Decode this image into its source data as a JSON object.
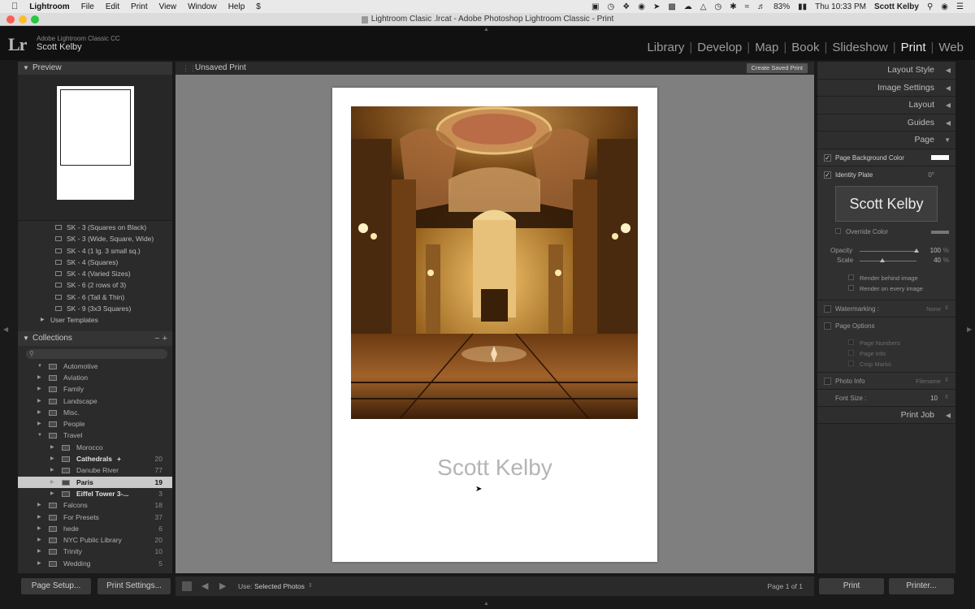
{
  "menubar": {
    "app": "Lightroom",
    "items": [
      "File",
      "Edit",
      "Print",
      "View",
      "Window",
      "Help"
    ],
    "battery": "83%",
    "clock": "Thu 10:33 PM",
    "user": "Scott Kelby"
  },
  "window": {
    "title": "Lightroom Clasic .lrcat - Adobe Photoshop Lightroom Classic - Print"
  },
  "identity": {
    "logo": "Lr",
    "app_version": "Adobe Lightroom Classic CC",
    "user": "Scott Kelby"
  },
  "modules": [
    {
      "label": "Library",
      "active": false
    },
    {
      "label": "Develop",
      "active": false
    },
    {
      "label": "Map",
      "active": false
    },
    {
      "label": "Book",
      "active": false
    },
    {
      "label": "Slideshow",
      "active": false
    },
    {
      "label": "Print",
      "active": true
    },
    {
      "label": "Web",
      "active": false
    }
  ],
  "left": {
    "preview_header": "Preview",
    "templates": [
      "SK - 3 (Squares on Black)",
      "SK - 3 (Wide, Square, Wide)",
      "SK - 4 (1 lg. 3 small sq.)",
      "SK - 4 (Squares)",
      "SK - 4 (Varied Sizes)",
      "SK - 6 (2 rows of 3)",
      "SK - 6 (Tall & Thin)",
      "SK - 9 (3x3 Squares)"
    ],
    "user_templates": "User Templates",
    "collections_header": "Collections",
    "collections_controls": "−  +",
    "collections": [
      {
        "name": "Automotive",
        "count": "",
        "level": 0,
        "expanded": true
      },
      {
        "name": "Aviation",
        "count": "",
        "level": 0
      },
      {
        "name": "Family",
        "count": "",
        "level": 0
      },
      {
        "name": "Landscape",
        "count": "",
        "level": 0
      },
      {
        "name": "Misc.",
        "count": "",
        "level": 0
      },
      {
        "name": "People",
        "count": "",
        "level": 0
      },
      {
        "name": "Travel",
        "count": "",
        "level": 0,
        "expanded": true
      },
      {
        "name": "Morocco",
        "count": "",
        "level": 1
      },
      {
        "name": "Cathedrals",
        "count": "20",
        "level": 1,
        "bright": true,
        "badge": "+"
      },
      {
        "name": "Danube River",
        "count": "77",
        "level": 1
      },
      {
        "name": "Paris",
        "count": "19",
        "level": 1,
        "selected": true
      },
      {
        "name": "Eiffel Tower 3-...",
        "count": "3",
        "level": 1,
        "bright": true
      },
      {
        "name": "Falcons",
        "count": "18",
        "level": 0
      },
      {
        "name": "For Presets",
        "count": "37",
        "level": 0
      },
      {
        "name": "hede",
        "count": "6",
        "level": 0
      },
      {
        "name": "NYC Public Library",
        "count": "20",
        "level": 0
      },
      {
        "name": "Trinity",
        "count": "10",
        "level": 0
      },
      {
        "name": "Wedding",
        "count": "5",
        "level": 0
      }
    ],
    "page_setup": "Page Setup...",
    "print_settings": "Print Settings..."
  },
  "center": {
    "header": "Unsaved Print",
    "create_saved_print": "Create Saved Print",
    "identity_plate_text": "Scott Kelby",
    "toolbar": {
      "use_label": "Use:",
      "use_value": "Selected Photos",
      "page_info": "Page 1 of 1"
    }
  },
  "right": {
    "sections_top": [
      "Layout Style",
      "Image Settings",
      "Layout",
      "Guides",
      "Page"
    ],
    "page_background_color": "Page Background Color",
    "identity_plate": "Identity Plate",
    "identity_plate_angle": "0°",
    "identity_plate_text": "Scott Kelby",
    "override_color": "Override Color",
    "opacity_label": "Opacity",
    "opacity_value": "100",
    "opacity_unit": "%",
    "scale_label": "Scale",
    "scale_value": "40",
    "scale_unit": "%",
    "opacity": 1.0,
    "scale": 0.4,
    "render_behind": "Render behind image",
    "render_every": "Render on every image",
    "watermarking": "Watermarking :",
    "watermark_value": "None",
    "page_options": "Page Options",
    "page_numbers": "Page Numbers",
    "page_info": "Page Info",
    "crop_marks": "Crop Marks",
    "photo_info": "Photo Info",
    "photo_info_value": "Filename",
    "font_size_label": "Font Size :",
    "font_size_value": "10",
    "print_job": "Print Job",
    "print_button": "Print",
    "printer_button": "Printer..."
  },
  "colors": {
    "accent": "#e6e6e6",
    "panel": "#2b2b2b",
    "canvas": "#7f7f7f"
  }
}
